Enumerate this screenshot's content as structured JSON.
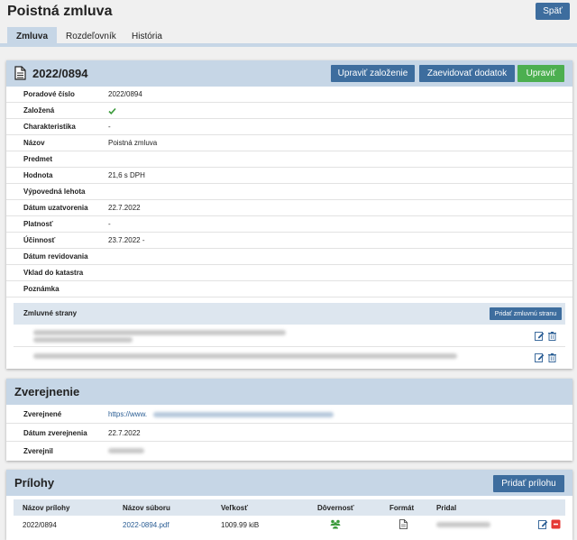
{
  "header": {
    "title": "Poistná zmluva",
    "back_label": "Späť"
  },
  "tabs": [
    {
      "label": "Zmluva",
      "active": true
    },
    {
      "label": "Rozdeľovník",
      "active": false
    },
    {
      "label": "História",
      "active": false
    }
  ],
  "contract": {
    "number": "2022/0894",
    "buttons": {
      "edit_filing": "Upraviť založenie",
      "add_amendment": "Zaevidovať dodatok",
      "edit": "Upraviť"
    },
    "fields": [
      {
        "label": "Poradové číslo",
        "value": "2022/0894"
      },
      {
        "label": "Založená",
        "value": ""
      },
      {
        "label": "Charakteristika",
        "value": "-"
      },
      {
        "label": "Názov",
        "value": "Poistná zmluva"
      },
      {
        "label": "Predmet",
        "value": ""
      },
      {
        "label": "Hodnota",
        "value": "21,6 s DPH"
      },
      {
        "label": "Výpovedná lehota",
        "value": ""
      },
      {
        "label": "Dátum uzatvorenia",
        "value": "22.7.2022"
      },
      {
        "label": "Platnosť",
        "value": "-"
      },
      {
        "label": "Účinnosť",
        "value": "23.7.2022 -"
      },
      {
        "label": "Dátum revidovania",
        "value": ""
      },
      {
        "label": "Vklad do katastra",
        "value": ""
      },
      {
        "label": "Poznámka",
        "value": ""
      }
    ],
    "parties_label": "Zmluvné strany",
    "add_party_label": "Pridať zmluvnú stranu"
  },
  "publication": {
    "title": "Zverejnenie",
    "published_label": "Zverejnené",
    "published_url": "https://www.",
    "date_label": "Dátum zverejnenia",
    "date_value": "22.7.2022",
    "by_label": "Zverejnil"
  },
  "attachments": {
    "title": "Prílohy",
    "add_label": "Pridať prílohu",
    "columns": [
      "Názov prílohy",
      "Názov súboru",
      "Veľkosť",
      "Dôvernosť",
      "Formát",
      "Pridal"
    ],
    "rows": [
      {
        "name": "2022/0894",
        "file": "2022-0894.pdf",
        "size": "1009.99 kiB"
      }
    ]
  },
  "colors": {
    "accent": "#3d6d9e",
    "header_bg": "#c6d6e6",
    "success": "#4caf50",
    "check": "#3a9a3a",
    "delete": "#e53935"
  }
}
